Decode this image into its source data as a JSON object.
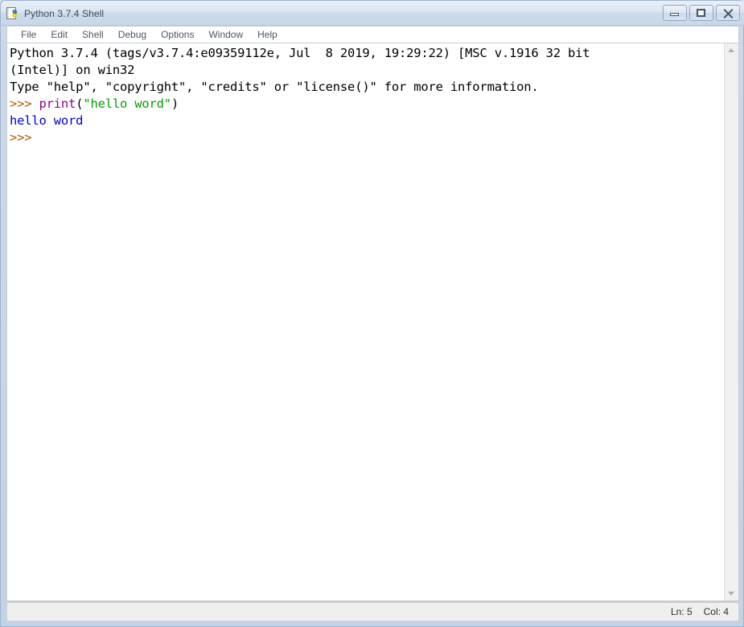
{
  "window": {
    "title": "Python 3.7.4 Shell",
    "icon": "python-idle-icon",
    "controls": {
      "minimize_label": "Minimize",
      "maximize_label": "Maximize",
      "close_label": "Close"
    }
  },
  "menubar": {
    "items": [
      {
        "label": "File"
      },
      {
        "label": "Edit"
      },
      {
        "label": "Shell"
      },
      {
        "label": "Debug"
      },
      {
        "label": "Options"
      },
      {
        "label": "Window"
      },
      {
        "label": "Help"
      }
    ]
  },
  "console": {
    "lines": [
      {
        "name": "banner-line-1",
        "tokens": [
          {
            "class": "tok-plain",
            "text": "Python 3.7.4 (tags/v3.7.4:e09359112e, Jul  8 2019, 19:29:22) [MSC v.1916 32 bit"
          }
        ]
      },
      {
        "name": "banner-line-2",
        "tokens": [
          {
            "class": "tok-plain",
            "text": "(Intel)] on win32"
          }
        ]
      },
      {
        "name": "banner-line-3",
        "tokens": [
          {
            "class": "tok-plain",
            "text": "Type \"help\", \"copyright\", \"credits\" or \"license()\" for more information."
          }
        ]
      },
      {
        "name": "input-line-1",
        "tokens": [
          {
            "class": "tok-prompt",
            "text": ">>> "
          },
          {
            "class": "tok-kw",
            "text": "print"
          },
          {
            "class": "tok-plain",
            "text": "("
          },
          {
            "class": "tok-str",
            "text": "\"hello word\""
          },
          {
            "class": "tok-plain",
            "text": ")"
          }
        ]
      },
      {
        "name": "output-line-1",
        "tokens": [
          {
            "class": "tok-out",
            "text": "hello word"
          }
        ]
      },
      {
        "name": "input-line-2",
        "tokens": [
          {
            "class": "tok-prompt",
            "text": ">>> "
          }
        ]
      }
    ]
  },
  "scrollbar": {
    "up_arrow": "chevron-up-icon",
    "down_arrow": "chevron-down-icon"
  },
  "statusbar": {
    "line_label": "Ln: 5",
    "col_label": "Col: 4"
  },
  "colors": {
    "prompt": "#b35900",
    "keyword": "#900090",
    "string": "#00a000",
    "output": "#0000cc",
    "text": "#000000",
    "console_bg": "#ffffff",
    "titlebar": "#dbe5f1",
    "frame": "#c9d7e9"
  }
}
